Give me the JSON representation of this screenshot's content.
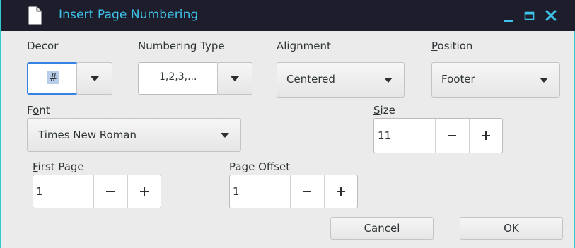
{
  "window": {
    "title": "Insert Page Numbering",
    "icon": "document-icon"
  },
  "decor": {
    "label": "Decor",
    "value": "#"
  },
  "numbering_type": {
    "label": "Numbering Type",
    "value": "1,2,3,..."
  },
  "alignment": {
    "label": "Alignment",
    "value": "Centered"
  },
  "position": {
    "label_mnemonic": "P",
    "label_rest": "osition",
    "value": "Footer"
  },
  "font": {
    "label_pre": "F",
    "label_mnemonic": "o",
    "label_rest": "nt",
    "value": "Times New Roman"
  },
  "size": {
    "label_mnemonic": "S",
    "label_rest": "ize",
    "value": "11"
  },
  "first_page": {
    "label_mnemonic": "F",
    "label_rest": "irst Page",
    "value": "1"
  },
  "page_offset": {
    "label": "Page Offset",
    "value": "1"
  },
  "buttons": {
    "cancel": "Cancel",
    "ok": "OK"
  },
  "colors": {
    "titlebar_bg": "#1d1d2b",
    "title_text": "#3fc3ea",
    "accent": "#33cccc",
    "focus_border": "#3584e4"
  }
}
